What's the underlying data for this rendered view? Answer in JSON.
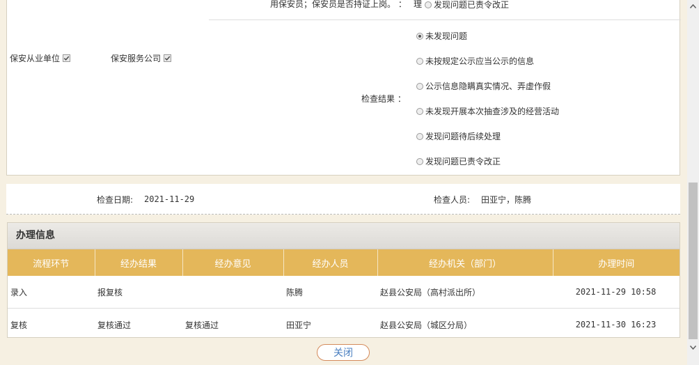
{
  "inspection": {
    "top_item_label": "用保安员；保安员是否持证上岗。 ：",
    "top_item_suffix": "理",
    "top_item_option": "发现问题已责令改正",
    "units": [
      {
        "label": "保安从业单位",
        "checked": true
      },
      {
        "label": "保安服务公司",
        "checked": true
      }
    ],
    "result_label": "检查结果 ：",
    "result_options": [
      {
        "label": "未发现问题",
        "checked": true
      },
      {
        "label": "未按规定公示应当公示的信息",
        "checked": false
      },
      {
        "label": "公示信息隐瞒真实情况、弄虚作假",
        "checked": false
      },
      {
        "label": "未发现开展本次抽查涉及的经营活动",
        "checked": false
      },
      {
        "label": "发现问题待后续处理",
        "checked": false
      },
      {
        "label": "发现问题已责令改正",
        "checked": false
      }
    ]
  },
  "info": {
    "date_label": "检查日期:",
    "date_value": "2021-11-29",
    "inspector_label": "检查人员:",
    "inspector_value": "田亚宁，陈腾"
  },
  "processing": {
    "title": "办理信息",
    "columns": [
      "流程环节",
      "经办结果",
      "经办意见",
      "经办人员",
      "经办机关（部门）",
      "办理时间"
    ],
    "rows": [
      [
        "录入",
        "报复核",
        "",
        "陈腾",
        "赵县公安局（高村派出所）",
        "2021-11-29 10:58"
      ],
      [
        "复核",
        "复核通过",
        "复核通过",
        "田亚宁",
        "赵县公安局（城区分局）",
        "2021-11-30 16:23"
      ]
    ]
  },
  "close_label": "关闭",
  "colors": {
    "header_gold": "#e4b75a",
    "button_text": "#4a7fc0",
    "button_border": "#d48a5a"
  },
  "icons": {
    "check": "checkmark-icon",
    "scroll_up": "chevron-up-icon",
    "scroll_down": "chevron-down-icon"
  }
}
